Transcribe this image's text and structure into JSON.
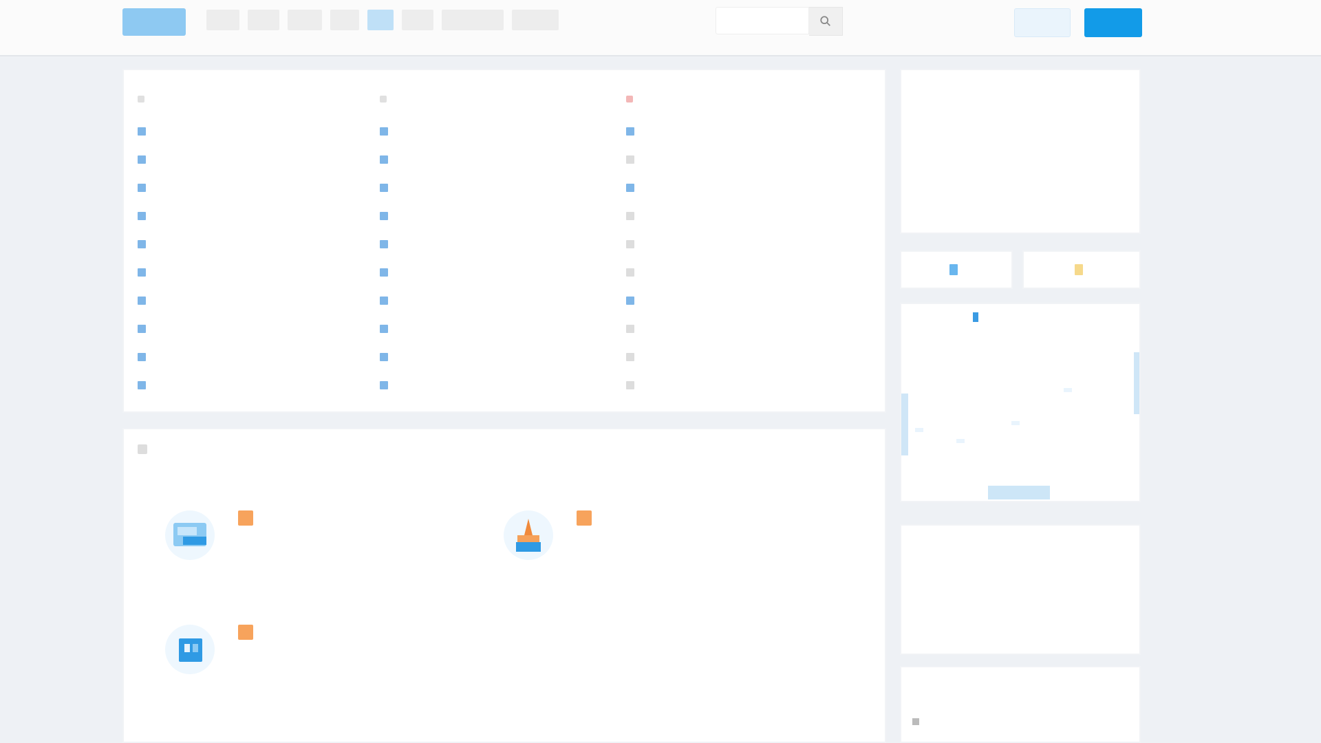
{
  "header": {
    "logo_text": "",
    "nav": [
      {
        "label": ""
      },
      {
        "label": ""
      },
      {
        "label": ""
      },
      {
        "label": ""
      },
      {
        "label": ""
      },
      {
        "label": ""
      },
      {
        "label": ""
      },
      {
        "label": ""
      }
    ],
    "active_nav_index": 5,
    "search_placeholder": "",
    "login_label": "",
    "register_label": ""
  },
  "news": {
    "columns": [
      {
        "title": "",
        "items": [
          "",
          "",
          "",
          "",
          "",
          "",
          "",
          "",
          "",
          ""
        ]
      },
      {
        "title": "",
        "items": [
          "",
          "",
          "",
          "",
          "",
          "",
          "",
          "",
          "",
          ""
        ]
      },
      {
        "title": "",
        "items": [
          "",
          "",
          "",
          "",
          "",
          "",
          "",
          "",
          "",
          ""
        ]
      }
    ]
  },
  "apps": {
    "title": "",
    "items": [
      {
        "name": "",
        "tag": "",
        "desc": "",
        "meta": "",
        "icon": "monitor-icon"
      },
      {
        "name": "",
        "tag": "",
        "desc": "",
        "meta": "",
        "icon": "rocket-icon"
      },
      {
        "name": "",
        "tag": "",
        "desc": "",
        "meta": "",
        "icon": "window-icon"
      }
    ]
  },
  "stats": {
    "items": [
      {
        "label": "",
        "value": ""
      },
      {
        "label": "",
        "value": ""
      },
      {
        "label": "",
        "value": ""
      },
      {
        "label": "",
        "value": ""
      },
      {
        "label": "",
        "value": ""
      },
      {
        "label": "",
        "value": ""
      }
    ]
  },
  "quick_actions": [
    {
      "label": "",
      "icon": "document-icon"
    },
    {
      "label": "",
      "icon": "folder-icon"
    }
  ],
  "map": {
    "heading": "",
    "labels": [
      "",
      "",
      "",
      ""
    ]
  },
  "links": {
    "rows": [
      {
        "a": "",
        "b": ""
      },
      {
        "a": "",
        "b": ""
      },
      {
        "a": "",
        "b": ""
      },
      {
        "a": "",
        "b": ""
      }
    ]
  },
  "notice": {
    "title": "",
    "items": [
      ""
    ]
  },
  "colors": {
    "accent": "#129be8",
    "accent_light": "#bfe0f7",
    "hot": "#f7a35c",
    "bg": "#eef1f5"
  }
}
